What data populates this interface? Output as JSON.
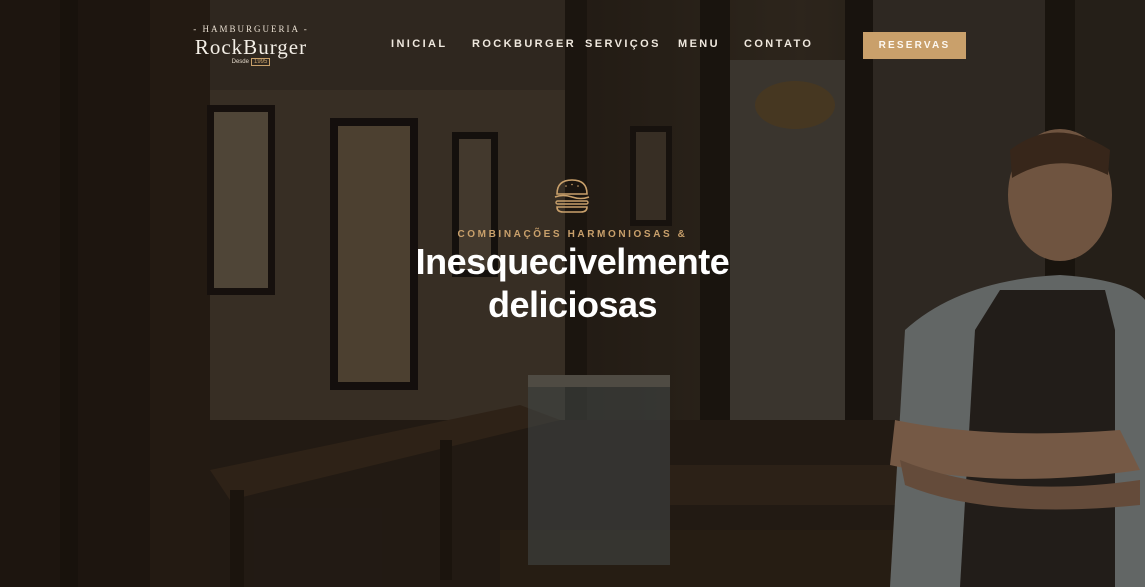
{
  "brand": {
    "top_text": "- HAMBURGUERIA -",
    "name": "RockBurger",
    "since_label": "Desde",
    "since_year": "1995"
  },
  "nav": {
    "items": [
      {
        "label": "INICIAL"
      },
      {
        "label": "ROCKBURGER"
      },
      {
        "label": "SERVIÇOS"
      },
      {
        "label": "MENU"
      },
      {
        "label": "CONTATO"
      }
    ],
    "cta_label": "RESERVAS"
  },
  "hero": {
    "tagline": "COMBINAÇÕES HARMONIOSAS &",
    "headline_line1": "Inesquecivelmente",
    "headline_line2": "deliciosas"
  },
  "colors": {
    "accent": "#c9a06b",
    "text_light": "#ffffff",
    "overlay": "#1e1712"
  },
  "icons": {
    "hero_icon": "burger-icon"
  }
}
